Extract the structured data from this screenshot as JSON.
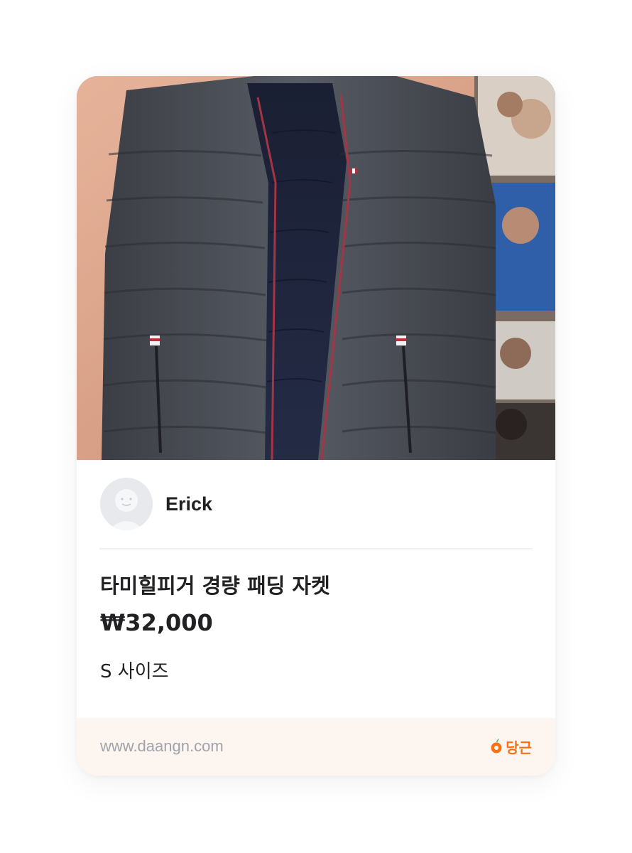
{
  "listing": {
    "photo_alt": "product-photo",
    "seller_name": "Erick",
    "title": "타미힐피거 경량 패딩 자켓",
    "price": "₩32,000",
    "description": "S 사이즈"
  },
  "footer": {
    "site_url": "www.daangn.com",
    "brand_name": "당근"
  },
  "colors": {
    "brand": "#ff6f0f",
    "text": "#212124",
    "muted": "#9fa3ab",
    "footer_bg": "#fdf5f0"
  },
  "icons": {
    "avatar": "default-avatar-icon",
    "brand": "carrot-logo-icon"
  }
}
